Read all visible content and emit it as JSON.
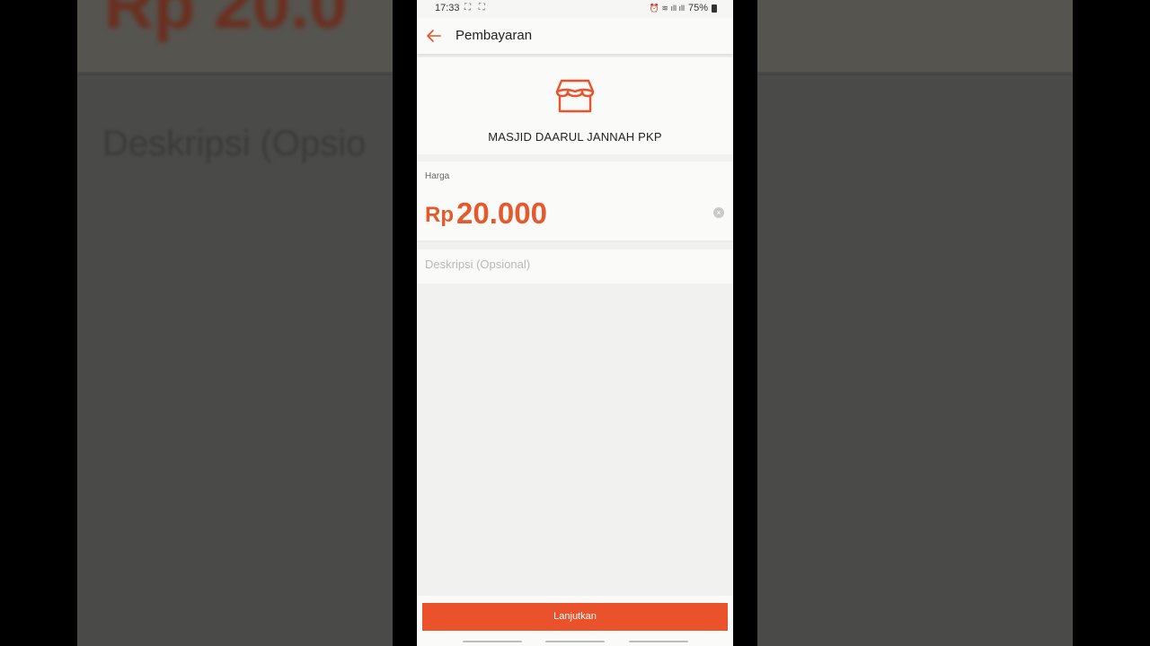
{
  "status_bar": {
    "time": "17:33",
    "left_icons": "⛶ ⛶",
    "right_icons": "⏰ ≋ ıll ıll",
    "battery": "75%"
  },
  "app_bar": {
    "title": "Pembayaran",
    "back_icon": "arrow-left-icon"
  },
  "merchant": {
    "icon": "store-icon",
    "name": "MASJID DAARUL JANNAH PKP"
  },
  "price": {
    "label": "Harga",
    "currency": "Rp",
    "value": "20.000",
    "clear_icon": "×"
  },
  "description": {
    "value": "",
    "placeholder": "Deskripsi (Opsional)"
  },
  "actions": {
    "continue_label": "Lanjutkan"
  },
  "background": {
    "amount": "Rp 20.0",
    "description": "Deskripsi (Opsio"
  },
  "colors": {
    "accent": "#e9522a",
    "price_text": "#e55a2d"
  }
}
